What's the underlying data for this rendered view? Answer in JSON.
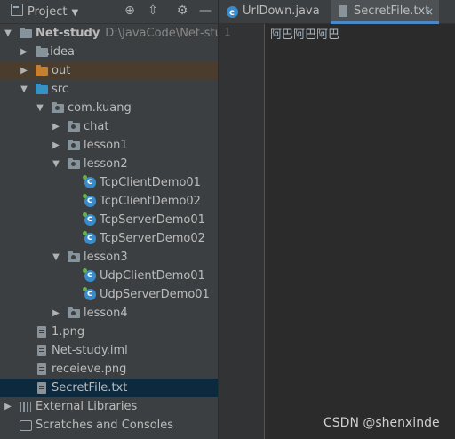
{
  "project_toolbar": {
    "title": "Project",
    "icons": [
      "crosshair-icon",
      "collapse-all-icon",
      "gear-icon",
      "minimize-icon"
    ]
  },
  "tree": {
    "root": {
      "label": "Net-study",
      "path": "D:\\JavaCode\\Net-study"
    },
    "idea": "idea",
    "out": "out",
    "src": "src",
    "package": "com.kuang",
    "chat": "chat",
    "lesson1": "lesson1",
    "lesson2": "lesson2",
    "lesson2_files": [
      "TcpClientDemo01",
      "TcpClientDemo02",
      "TcpServerDemo01",
      "TcpServerDemo02"
    ],
    "lesson3": "lesson3",
    "lesson3_files": [
      "UdpClientDemo01",
      "UdpServerDemo01"
    ],
    "lesson4": "lesson4",
    "files": [
      "1.png",
      "Net-study.iml",
      "receieve.png",
      "SecretFile.txt"
    ],
    "external_libraries": "External Libraries",
    "scratches": "Scratches and Consoles"
  },
  "editor": {
    "tabs": [
      {
        "label": "UrlDown.java",
        "active": false
      },
      {
        "label": "SecretFile.txt",
        "active": true,
        "close": "×"
      }
    ],
    "line_numbers": [
      "1"
    ],
    "lines": [
      "阿巴阿巴阿巴"
    ]
  },
  "watermark": "CSDN @shenxinde",
  "colors": {
    "selected_row": "#0d293e",
    "excluded_folder_row": "#4a3d2e",
    "active_tab_underline": "#4a88c7"
  }
}
